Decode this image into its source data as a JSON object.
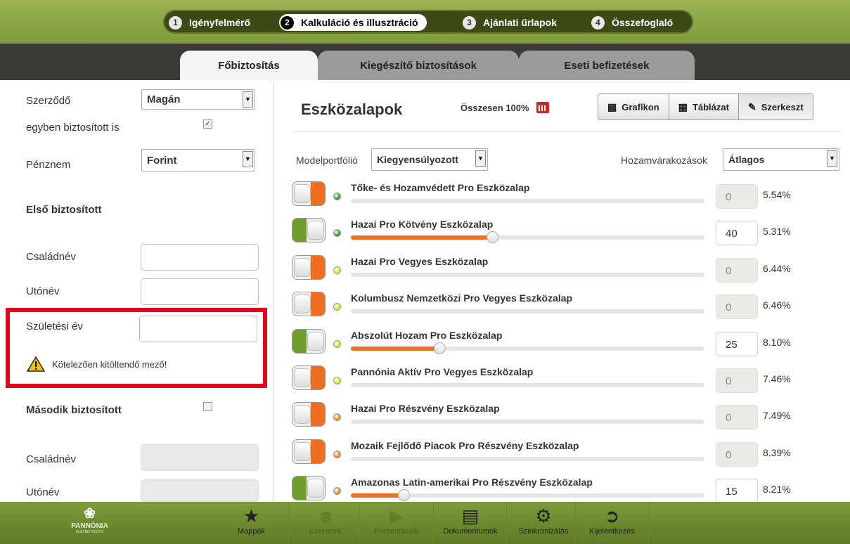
{
  "steps": [
    {
      "num": "1",
      "label": "Igényfelmérő"
    },
    {
      "num": "2",
      "label": "Kalkuláció és illusztráció"
    },
    {
      "num": "3",
      "label": "Ajánlati űrlapok"
    },
    {
      "num": "4",
      "label": "Összefoglaló"
    }
  ],
  "tabs": [
    {
      "label": "Főbiztosítás"
    },
    {
      "label": "Kiegészítő biztosítások"
    },
    {
      "label": "Eseti befizetések"
    }
  ],
  "left": {
    "contract_label": "Szerződő",
    "contract_value": "Magán",
    "also_insured_label": "egyben biztosított is",
    "currency_label": "Pénznem",
    "currency_value": "Forint",
    "first_insured_heading": "Első biztosított",
    "lastname_label": "Családnév",
    "firstname_label": "Utónév",
    "birthyear_label": "Születési év",
    "required_warning": "Kötelezően kitöltendő mező!",
    "second_insured_heading": "Második biztosított",
    "lastname2_label": "Családnév",
    "firstname2_label": "Utónév"
  },
  "right": {
    "title": "Eszközalapok",
    "total": "Összesen 100%",
    "buttons": [
      {
        "label": "Grafikon",
        "icon": "chart-icon"
      },
      {
        "label": "Táblázat",
        "icon": "table-icon"
      },
      {
        "label": "Szerkeszt",
        "icon": "pencil-icon"
      }
    ],
    "model_label": "Modelportfólió",
    "model_value": "Kiegyensúlyozott",
    "yield_label": "Hozamvárakozások",
    "yield_value": "Átlagos"
  },
  "funds": [
    {
      "name": "Tőke- és Hozamvédett Pro Eszközalap",
      "value": "0",
      "pct": "5.54%",
      "enabled": false,
      "risk": "#2ea12a",
      "share": 0
    },
    {
      "name": "Hazai Pro Kötvény Eszközalap",
      "value": "40",
      "pct": "5.31%",
      "enabled": true,
      "risk": "#2ea12a",
      "share": 0.4
    },
    {
      "name": "Hazai Pro Vegyes Eszközalap",
      "value": "0",
      "pct": "6.44%",
      "enabled": false,
      "risk": "#e8e02a",
      "share": 0
    },
    {
      "name": "Kolumbusz Nemzetközi Pro Vegyes Eszközalap",
      "value": "0",
      "pct": "6.46%",
      "enabled": false,
      "risk": "#e8e02a",
      "share": 0
    },
    {
      "name": "Abszolút Hozam Pro Eszközalap",
      "value": "25",
      "pct": "8.10%",
      "enabled": true,
      "risk": "#e8e02a",
      "share": 0.25
    },
    {
      "name": "Pannónia Aktív Pro Vegyes Eszközalap",
      "value": "0",
      "pct": "7.46%",
      "enabled": false,
      "risk": "#e8e02a",
      "share": 0
    },
    {
      "name": "Hazai Pro Részvény Eszközalap",
      "value": "0",
      "pct": "7.49%",
      "enabled": false,
      "risk": "#ef8a1a",
      "share": 0
    },
    {
      "name": "Mozaik Fejlődő Piacok Pro Részvény Eszközalap",
      "value": "0",
      "pct": "8.39%",
      "enabled": false,
      "risk": "#ef8a1a",
      "share": 0
    },
    {
      "name": "Amazonas Latin-amerikai Pro Részvény Eszközalap",
      "value": "15",
      "pct": "8.21%",
      "enabled": true,
      "risk": "#ef8a1a",
      "share": 0.15
    }
  ],
  "bottom": {
    "logo": "PANNÓNIA",
    "logo_sub": "ÉLETBIZTOSÍTÓ",
    "nav": [
      {
        "label": "Mappák",
        "icon": "star-icon"
      },
      {
        "label": "Üzenetek",
        "icon": "people-icon"
      },
      {
        "label": "Prezentációk",
        "icon": "presentation-icon"
      },
      {
        "label": "Dokumentumok",
        "icon": "document-icon"
      },
      {
        "label": "Szinkronizálás",
        "icon": "gear-icon"
      },
      {
        "label": "Kijelentkezés",
        "icon": "logout-icon"
      }
    ]
  }
}
